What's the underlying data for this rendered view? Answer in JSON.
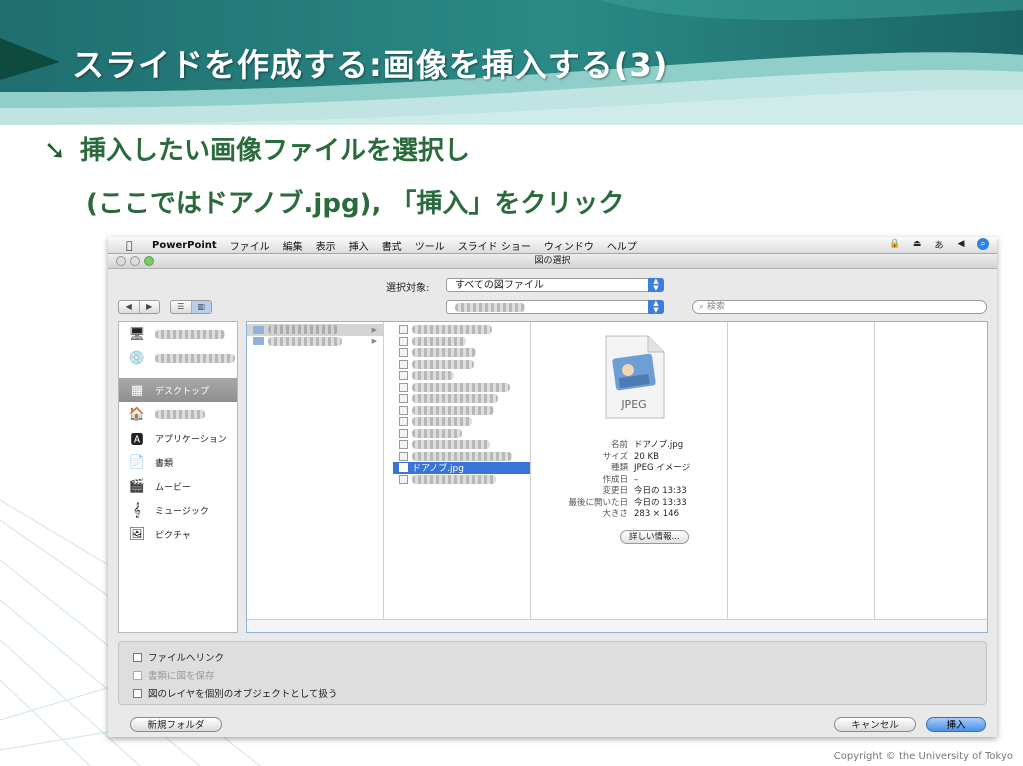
{
  "slide": {
    "title": "スライドを作成する:画像を挿入する(3)",
    "bullet_symbol": "➘",
    "line1": "挿入したい画像ファイルを選択し",
    "line2": "(ここではドアノブ.jpg), 「挿入」をクリック",
    "copyright": "Copyright © the University of Tokyo"
  },
  "menubar": {
    "app": "PowerPoint",
    "items": [
      "ファイル",
      "編集",
      "表示",
      "挿入",
      "書式",
      "ツール",
      "スライド ショー",
      "ウィンドウ",
      "ヘルプ"
    ]
  },
  "dialog": {
    "title": "図の選択",
    "show_label": "選択対象:",
    "show_value": "すべての図ファイル",
    "search_placeholder": "検索",
    "sidebar": [
      {
        "label": "",
        "icon": "monitor-icon",
        "blurred": true
      },
      {
        "label": "",
        "icon": "network-disk-icon",
        "blurred": true
      },
      {
        "label": "デスクトップ",
        "icon": "desktop-icon",
        "blurred": false,
        "selected": true
      },
      {
        "label": "",
        "icon": "home-icon",
        "blurred": true
      },
      {
        "label": "アプリケーション",
        "icon": "applications-icon",
        "blurred": false
      },
      {
        "label": "書類",
        "icon": "documents-icon",
        "blurred": false
      },
      {
        "label": "ムービー",
        "icon": "movies-icon",
        "blurred": false
      },
      {
        "label": "ミュージック",
        "icon": "music-icon",
        "blurred": false
      },
      {
        "label": "ピクチャ",
        "icon": "pictures-icon",
        "blurred": false
      }
    ],
    "selected_file": "ドアノブ.jpg",
    "preview": {
      "icon_label": "JPEG",
      "info": [
        {
          "k": "名前",
          "v": "ドアノブ.jpg"
        },
        {
          "k": "サイズ",
          "v": "20 KB"
        },
        {
          "k": "種類",
          "v": "JPEG イメージ"
        },
        {
          "k": "作成日",
          "v": "–"
        },
        {
          "k": "変更日",
          "v": "今日の 13:33"
        },
        {
          "k": "最後に開いた日",
          "v": "今日の 13:33"
        },
        {
          "k": "大きさ",
          "v": "283 × 146"
        }
      ],
      "more_info": "詳しい情報..."
    },
    "options": {
      "link": "ファイルへリンク",
      "save_with_doc": "書類に図を保存",
      "layers": "図のレイヤを個別のオブジェクトとして扱う"
    },
    "buttons": {
      "new_folder": "新規フォルダ",
      "cancel": "キャンセル",
      "insert": "挿入"
    }
  }
}
